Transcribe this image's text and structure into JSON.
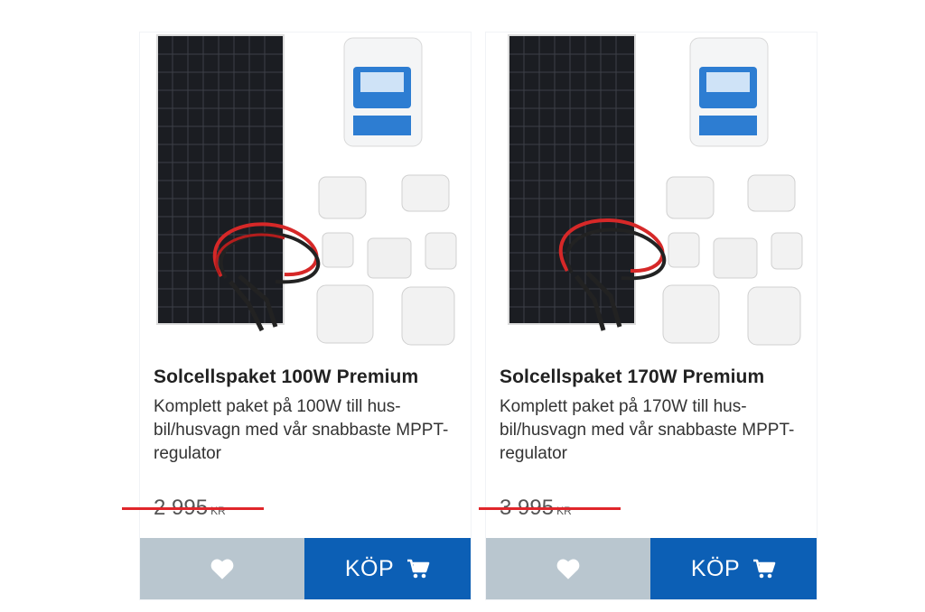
{
  "products": [
    {
      "title": "Solcellspaket 100W Premium",
      "description": "Komplett paket på 100W till hus­bil/husvagn med vår snabbaste MPPT-regulator",
      "price": {
        "amount": "2 995",
        "currency": "KR"
      },
      "favorite_icon": "heart-icon",
      "buy_label": "KÖP",
      "cart_icon": "cart-icon"
    },
    {
      "title": "Solcellspaket 170W Premium",
      "description": "Komplett paket på 170W till hus­bil/husvagn med vår snabbaste MPPT-regulator",
      "price": {
        "amount": "3 995",
        "currency": "KR"
      },
      "favorite_icon": "heart-icon",
      "buy_label": "KÖP",
      "cart_icon": "cart-icon"
    }
  ],
  "colors": {
    "buy_button": "#0c5fb5",
    "favorite_button": "#b9c6cf",
    "strike": "#e0262b"
  }
}
